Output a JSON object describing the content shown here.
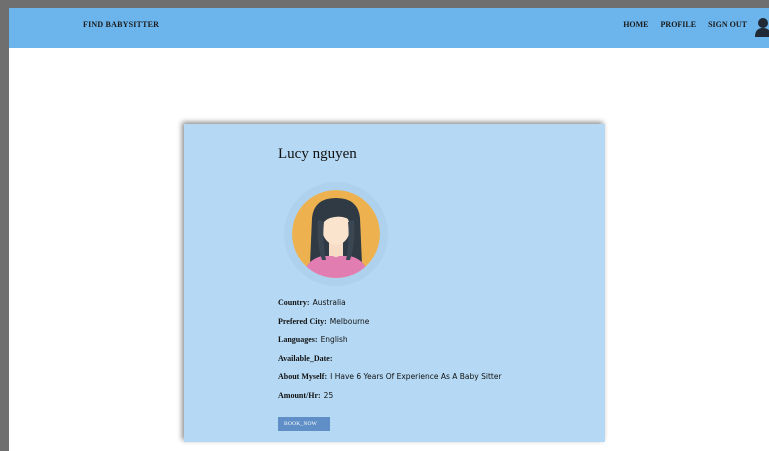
{
  "navbar": {
    "brand": "FIND BABYSITTER",
    "links": [
      "HOME",
      "PROFILE",
      "SIGN OUT"
    ],
    "user_icon": "user-icon"
  },
  "profile": {
    "name": "Lucy nguyen",
    "avatar_icon": "female-avatar",
    "fields": [
      {
        "label": "Country:",
        "value": "Australia"
      },
      {
        "label": "Prefered City:",
        "value": "Melbourne"
      },
      {
        "label": "Languages:",
        "value": "English"
      },
      {
        "label": "Available_Date:",
        "value": ""
      },
      {
        "label": "About Myself:",
        "value": "I Have 6 Years Of Experience As A Baby Sitter"
      },
      {
        "label": "Amount/Hr:",
        "value": "25"
      }
    ],
    "book_button": "BOOK_NOW"
  },
  "colors": {
    "navbar": "#6cb4ec",
    "card": "#b5d9f4",
    "button": "#5f8fc6"
  }
}
